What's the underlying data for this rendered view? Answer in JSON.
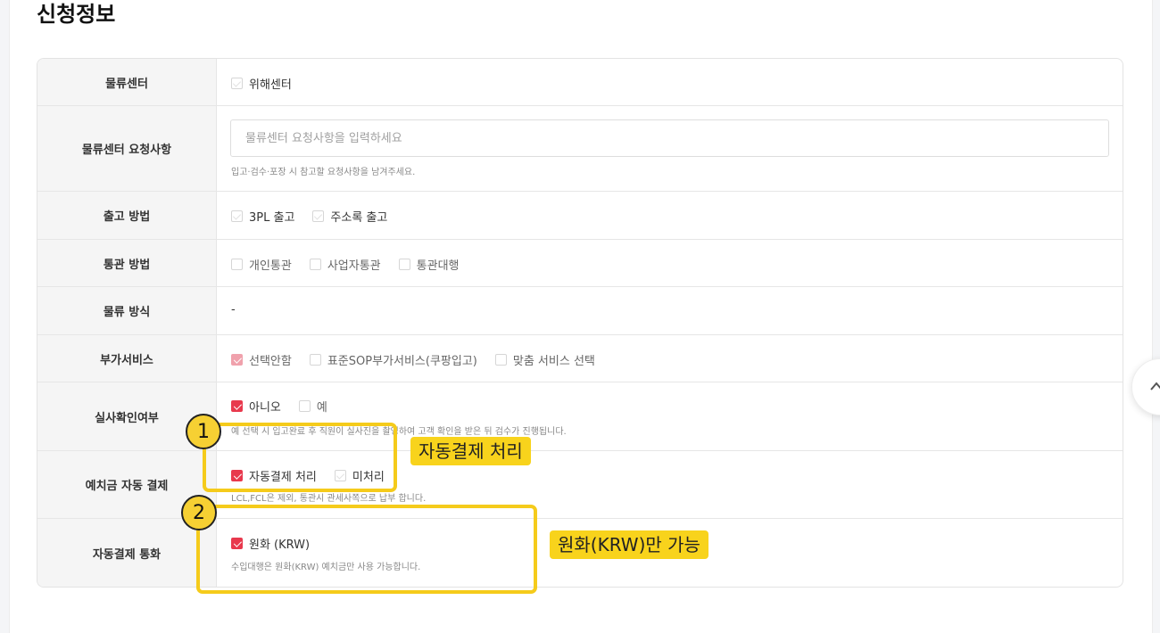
{
  "section_title": "신청정보",
  "rows": {
    "logistics_center": {
      "label": "물류센터",
      "options": [
        {
          "label": "위해센터",
          "checked": false
        }
      ]
    },
    "center_request": {
      "label": "물류센터 요청사항",
      "placeholder": "물류센터 요청사항을 입력하세요",
      "value": "",
      "helper": "입고·검수·포장 시 참고할 요청사항을 남겨주세요."
    },
    "shipping_method": {
      "label": "출고 방법",
      "options": [
        {
          "label": "3PL 출고",
          "checked": false
        },
        {
          "label": "주소록 출고",
          "checked": false
        }
      ]
    },
    "customs_method": {
      "label": "통관 방법",
      "options": [
        {
          "label": "개인통관",
          "checked": false
        },
        {
          "label": "사업자통관",
          "checked": false
        },
        {
          "label": "통관대행",
          "checked": false
        }
      ]
    },
    "logistics_type": {
      "label": "물류 방식",
      "value": "-"
    },
    "extra_service": {
      "label": "부가서비스",
      "options": [
        {
          "label": "선택안함",
          "checked": true
        },
        {
          "label": "표준SOP부가서비스(쿠팡입고)",
          "checked": false
        },
        {
          "label": "맞춤 서비스 선택",
          "checked": false
        }
      ]
    },
    "inspection_check": {
      "label": "실사확인여부",
      "options": [
        {
          "label": "아니오",
          "checked": true
        },
        {
          "label": "예",
          "checked": false
        }
      ],
      "helper": "예 선택 시 입고완료 후 직원이 실사진을 촬영하여 고객 확인을 받은 뒤 검수가 진행됩니다."
    },
    "deposit_auto_pay": {
      "label": "예치금 자동 결제",
      "options": [
        {
          "label": "자동결제 처리",
          "checked": true
        },
        {
          "label": "미처리",
          "checked": false
        }
      ],
      "helper": "LCL,FCL은 제외, 통관시 관세사쪽으로 납부 합니다."
    },
    "auto_pay_currency": {
      "label": "자동결제 통화",
      "options": [
        {
          "label": "원화 (KRW)",
          "checked": true
        }
      ],
      "helper": "수입대행은 원화(KRW) 예치금만 사용 가능합니다."
    }
  },
  "annotations": [
    {
      "number": "1",
      "text": "자동결제 처리"
    },
    {
      "number": "2",
      "text": "원화(KRW)만 가능"
    }
  ],
  "colors": {
    "checkbox_checked": "#e8394d",
    "annotation": "#f5cb1b"
  }
}
